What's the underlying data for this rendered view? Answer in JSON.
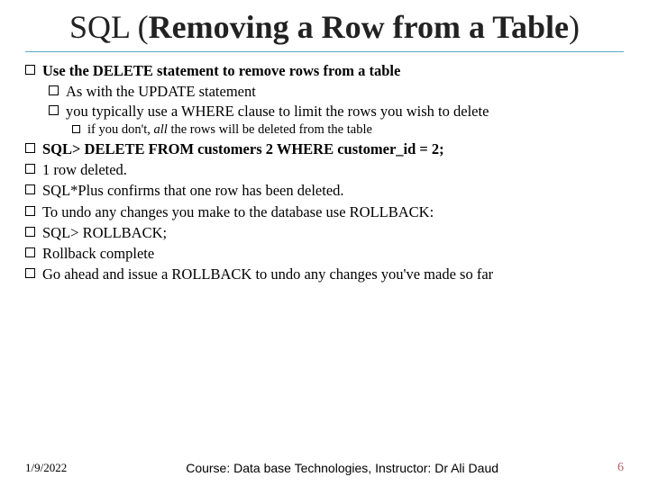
{
  "title": {
    "prefix": "SQL (",
    "bold": "Removing a Row from a Table",
    "suffix": ")"
  },
  "bullets": {
    "b1": "Use the DELETE statement to remove rows from a table",
    "b1a": "As with the UPDATE statement",
    "b1b": "you typically use a WHERE clause to limit the rows you wish to delete",
    "b1b_i_pre": "if you don't, ",
    "b1b_i_ital": "all",
    "b1b_i_post": " the rows will be deleted from the table",
    "b2": "SQL> DELETE FROM customers  2  WHERE customer_id = 2;",
    "b3": "1 row deleted.",
    "b4": "SQL*Plus confirms that one row has been deleted.",
    "b5": "To undo any changes you make to the database use ROLLBACK:",
    "b6": "SQL> ROLLBACK;",
    "b7": "Rollback complete",
    "b8": "Go ahead and issue a ROLLBACK to undo any changes you've made so far"
  },
  "footer": {
    "date": "1/9/2022",
    "course": "Course: Data base Technologies, Instructor: Dr Ali Daud",
    "page": "6"
  }
}
